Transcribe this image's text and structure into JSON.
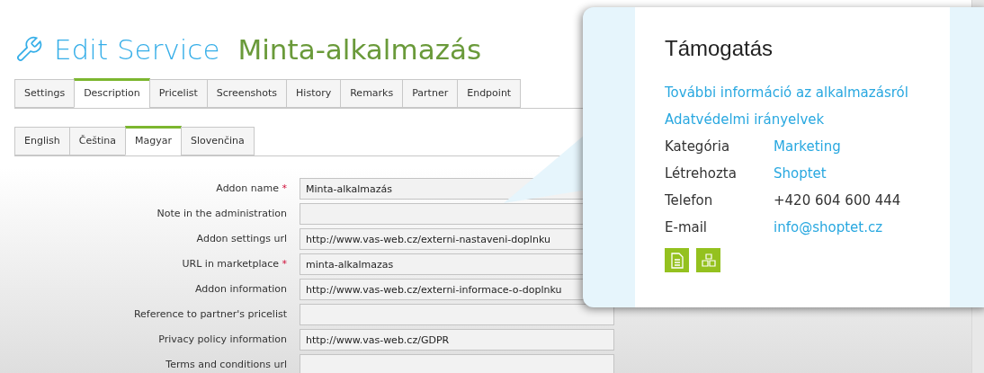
{
  "header": {
    "title": "Edit Service",
    "subtitle": "Minta-alkalmazás"
  },
  "tabs": [
    {
      "label": "Settings",
      "selected": false
    },
    {
      "label": "Description",
      "selected": true
    },
    {
      "label": "Pricelist",
      "selected": false
    },
    {
      "label": "Screenshots",
      "selected": false
    },
    {
      "label": "History",
      "selected": false
    },
    {
      "label": "Remarks",
      "selected": false
    },
    {
      "label": "Partner",
      "selected": false
    },
    {
      "label": "Endpoint",
      "selected": false
    }
  ],
  "language_tabs": [
    {
      "label": "English",
      "selected": false
    },
    {
      "label": "Čeština",
      "selected": false
    },
    {
      "label": "Magyar",
      "selected": true
    },
    {
      "label": "Slovenčina",
      "selected": false
    }
  ],
  "form": [
    {
      "label": "Addon name",
      "required_mark": "*",
      "value": "Minta-alkalmazás"
    },
    {
      "label": "Note in the administration"
    },
    {
      "label": "Addon settings url",
      "value": "http://www.vas-web.cz/externi-nastaveni-doplnku"
    },
    {
      "label": "URL in marketplace",
      "required_mark": "*",
      "value": "minta-alkalmazas"
    },
    {
      "label": "Addon information",
      "value": "http://www.vas-web.cz/externi-informace-o-doplnku"
    },
    {
      "label": "Reference to partner's pricelist"
    },
    {
      "label": "Privacy policy information",
      "value": "http://www.vas-web.cz/GDPR"
    },
    {
      "label": "Terms and conditions url"
    }
  ],
  "support_popup": {
    "title": "Támogatás",
    "links": [
      "További információ az alkalmazásról",
      "Adatvédelmi irányelvek"
    ],
    "details": [
      {
        "label": "Kategória",
        "value": "Marketing",
        "kind": "link"
      },
      {
        "label": "Létrehozta",
        "value": "Shoptet",
        "kind": "link"
      },
      {
        "label": "Telefon",
        "value": "+420 604 600 444",
        "kind": "text"
      },
      {
        "label": "E-mail",
        "value": "info@shoptet.cz",
        "kind": "link"
      }
    ]
  }
}
